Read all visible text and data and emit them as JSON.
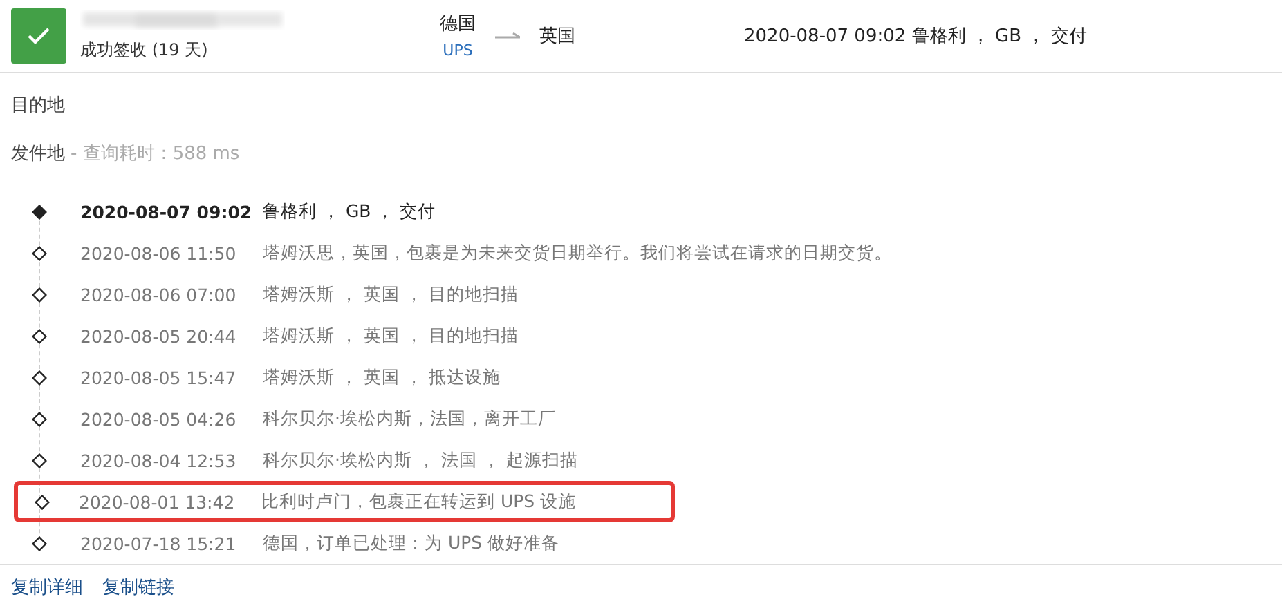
{
  "header": {
    "status": "成功签收 (19 天)",
    "origin": "德国",
    "carrier": "UPS",
    "destination": "英国",
    "latest": {
      "time": "2020-08-07 09:02",
      "text": "鲁格利 ， GB ， 交付"
    }
  },
  "destination_label": "目的地",
  "origin_section": {
    "label": "发件地",
    "query_info": "- 查询耗时：588 ms"
  },
  "events": [
    {
      "time": "2020-08-07 09:02",
      "text": "鲁格利 ， GB ， 交付",
      "current": true,
      "highlighted": false
    },
    {
      "time": "2020-08-06 11:50",
      "text": "塔姆沃思，英国，包裹是为未来交货日期举行。我们将尝试在请求的日期交货。",
      "current": false,
      "highlighted": false
    },
    {
      "time": "2020-08-06 07:00",
      "text": "塔姆沃斯 ， 英国 ， 目的地扫描",
      "current": false,
      "highlighted": false
    },
    {
      "time": "2020-08-05 20:44",
      "text": "塔姆沃斯 ， 英国 ， 目的地扫描",
      "current": false,
      "highlighted": false
    },
    {
      "time": "2020-08-05 15:47",
      "text": "塔姆沃斯 ， 英国 ， 抵达设施",
      "current": false,
      "highlighted": false
    },
    {
      "time": "2020-08-05 04:26",
      "text": "科尔贝尔·埃松内斯，法国，离开工厂",
      "current": false,
      "highlighted": false
    },
    {
      "time": "2020-08-04 12:53",
      "text": "科尔贝尔·埃松内斯 ， 法国 ， 起源扫描",
      "current": false,
      "highlighted": false
    },
    {
      "time": "2020-08-01 13:42",
      "text": "比利时卢门，包裹正在转运到 UPS 设施",
      "current": false,
      "highlighted": true
    },
    {
      "time": "2020-07-18 15:21",
      "text": "德国，订单已处理：为 UPS 做好准备",
      "current": false,
      "highlighted": false
    }
  ],
  "footer_links": [
    "复制详细",
    "复制链接"
  ]
}
